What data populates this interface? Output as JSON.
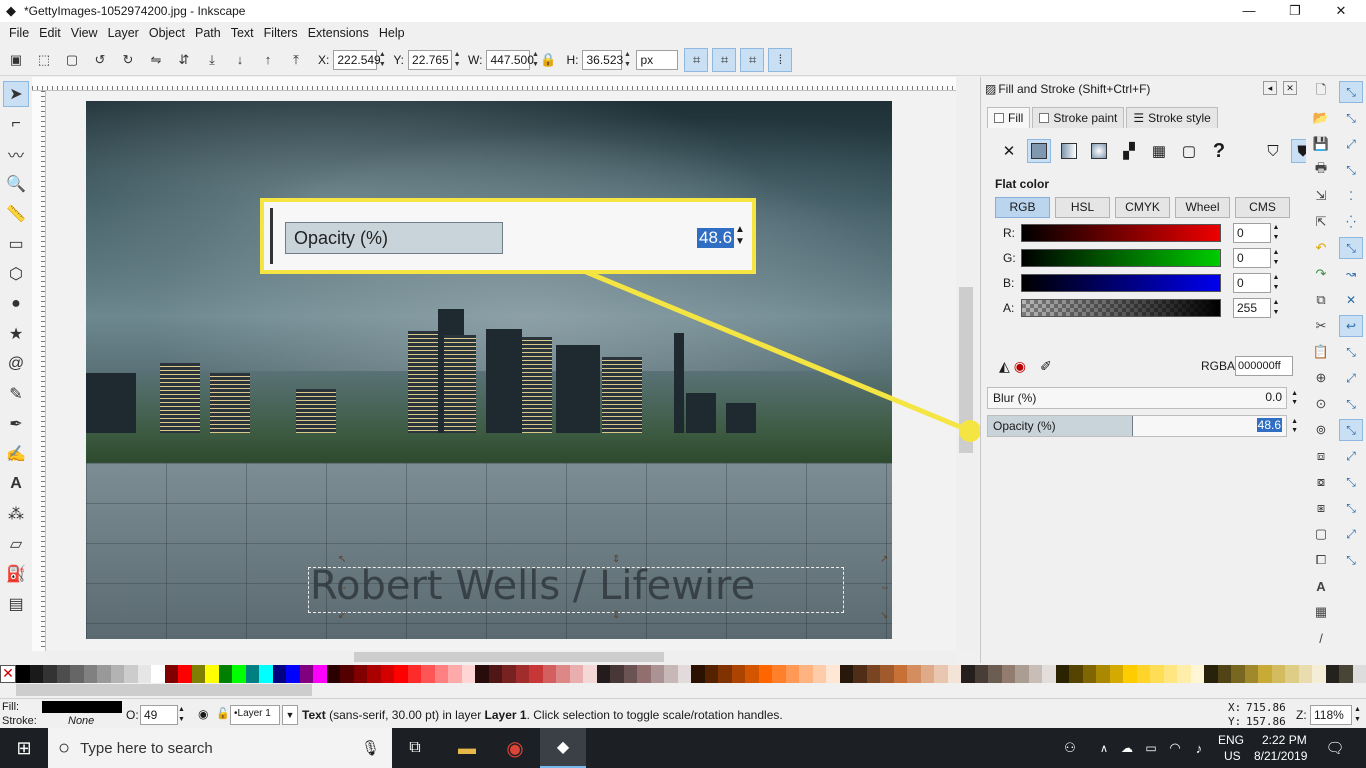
{
  "window": {
    "title": "*GettyImages-1052974200.jpg - Inkscape",
    "app_icon": "inkscape-logo-icon",
    "controls": {
      "minimize": "—",
      "restore": "❐",
      "close": "✕"
    }
  },
  "menu": [
    "File",
    "Edit",
    "View",
    "Layer",
    "Object",
    "Path",
    "Text",
    "Filters",
    "Extensions",
    "Help"
  ],
  "tool_controls": {
    "x_label": "X:",
    "x_value": "222.549",
    "y_label": "Y:",
    "y_value": "22.765",
    "w_label": "W:",
    "w_value": "447.500",
    "h_label": "H:",
    "h_value": "36.523",
    "unit": "px"
  },
  "tools": [
    "selector-tool-icon",
    "node-tool-icon",
    "tweak-tool-icon",
    "zoom-tool-icon",
    "measure-tool-icon",
    "rectangle-tool-icon",
    "3d-box-tool-icon",
    "ellipse-tool-icon",
    "star-tool-icon",
    "spiral-tool-icon",
    "pencil-tool-icon",
    "pen-tool-icon",
    "calligraphy-tool-icon",
    "text-tool-icon",
    "spray-tool-icon",
    "eraser-tool-icon",
    "paint-bucket-tool-icon",
    "gradient-tool-icon"
  ],
  "canvas": {
    "text": "Robert Wells / Lifewire"
  },
  "callout": {
    "label": "Opacity (%)",
    "value": "48.6",
    "color": "#f4e542"
  },
  "panel": {
    "title": "Fill and Stroke (Shift+Ctrl+F)",
    "tabs": [
      "Fill",
      "Stroke paint",
      "Stroke style"
    ],
    "flat_color_label": "Flat color",
    "modes": [
      "RGB",
      "HSL",
      "CMYK",
      "Wheel",
      "CMS"
    ],
    "channels": [
      {
        "label": "R:",
        "value": "0"
      },
      {
        "label": "G:",
        "value": "0"
      },
      {
        "label": "B:",
        "value": "0"
      },
      {
        "label": "A:",
        "value": "255"
      }
    ],
    "rgba_label": "RGBA:",
    "rgba_value": "000000ff",
    "blur_label": "Blur (%)",
    "blur_value": "0.0",
    "opacity_label": "Opacity (%)",
    "opacity_value": "48.6",
    "opacity_level": 0.486
  },
  "status": {
    "fill_label": "Fill:",
    "stroke_label": "Stroke:",
    "stroke_value": "None",
    "opacity_label": "O:",
    "opacity_value": "49",
    "layer": "•Layer 1",
    "message_bold": "Text",
    "message": " (sans-serif, 30.00 pt) in layer ",
    "message_layer": "Layer 1",
    "message_tail": ". Click selection to toggle scale/rotation handles.",
    "cursor_x_label": "X:",
    "cursor_x": "715.86",
    "cursor_y_label": "Y:",
    "cursor_y": "157.86",
    "zoom_label": "Z:",
    "zoom": "118%"
  },
  "taskbar": {
    "search_placeholder": "Type here to search",
    "lang1": "ENG",
    "lang2": "US",
    "time": "2:22 PM",
    "date": "8/21/2019"
  },
  "palette": [
    "#000000",
    "#1a1a1a",
    "#333333",
    "#4d4d4d",
    "#666666",
    "#808080",
    "#999999",
    "#b3b3b3",
    "#cccccc",
    "#e6e6e6",
    "#ffffff",
    "#800000",
    "#ff0000",
    "#808000",
    "#ffff00",
    "#008000",
    "#00ff00",
    "#008080",
    "#00ffff",
    "#000080",
    "#0000ff",
    "#800080",
    "#ff00ff",
    "#2b0000",
    "#550000",
    "#800000",
    "#aa0000",
    "#d40000",
    "#ff0000",
    "#ff2a2a",
    "#ff5555",
    "#ff8080",
    "#ffaaaa",
    "#ffd5d5",
    "#280b0b",
    "#501616",
    "#782121",
    "#a02c2c",
    "#c83737",
    "#d35f5f",
    "#de8787",
    "#e9afaf",
    "#f4d7d7",
    "#241c1c",
    "#483737",
    "#6c5353",
    "#916f6f",
    "#ac9393",
    "#c8b7b7",
    "#e3dbdb",
    "#2b1100",
    "#552200",
    "#803300",
    "#aa4400",
    "#d45500",
    "#ff6600",
    "#ff7f2a",
    "#ff9955",
    "#ffb380",
    "#ffccaa",
    "#ffe6d5",
    "#28170b",
    "#502d16",
    "#784421",
    "#a05a2c",
    "#c87137",
    "#d38d5f",
    "#deaa87",
    "#e9c6af",
    "#f4e3d7",
    "#241f1c",
    "#483e37",
    "#6c5d53",
    "#917c6f",
    "#ac9d93",
    "#c8beb7",
    "#e3dedb",
    "#2b2200",
    "#554400",
    "#806600",
    "#aa8800",
    "#d4aa00",
    "#ffcc00",
    "#ffd42a",
    "#ffdd55",
    "#ffe680",
    "#ffeeaa",
    "#fff6d5",
    "#28220b",
    "#504416",
    "#786721",
    "#a0892c",
    "#c8ab37",
    "#d3bc5f",
    "#decd87",
    "#e9ddaf",
    "#f4eed7",
    "#24221c",
    "#484537"
  ]
}
